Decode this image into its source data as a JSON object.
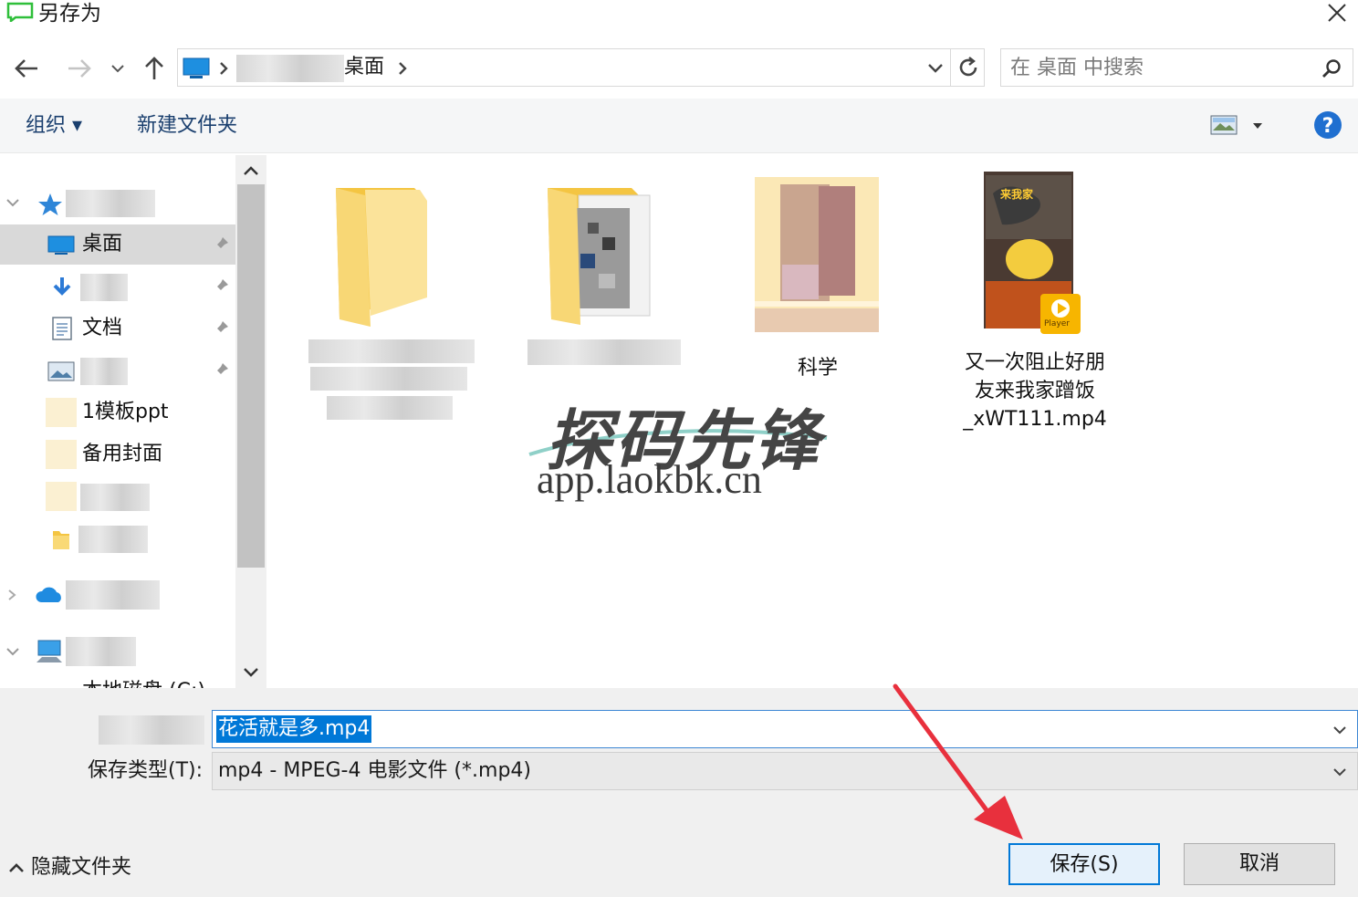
{
  "window": {
    "title": "另存为"
  },
  "address": {
    "current_folder": "桌面"
  },
  "search": {
    "placeholder": "在 桌面 中搜索"
  },
  "toolbar": {
    "organize_label": "组织 ▾",
    "new_folder_label": "新建文件夹"
  },
  "sidebar": {
    "items": [
      {
        "label": "桌面"
      },
      {
        "label": "文档"
      },
      {
        "label": "1模板ppt"
      },
      {
        "label": "备用封面"
      },
      {
        "label": "本地磁盘 (C:)"
      }
    ]
  },
  "files": [
    {
      "name": "科学"
    },
    {
      "name": "又一次阻止好朋友来我家蹭饭_xWT111.mp4",
      "lines": [
        "又一次阻止好朋",
        "友来我家蹭饭",
        "_xWT111.mp4"
      ]
    }
  ],
  "thumbnail_text": {
    "video_caption": "来我家",
    "player_label": "Player"
  },
  "watermark": {
    "title": "探码先锋",
    "url": "app.laokbk.cn"
  },
  "form": {
    "filename_value": "花活就是多.mp4",
    "filetype_label": "保存类型(T):",
    "filetype_value": "mp4 - MPEG-4 电影文件 (*.mp4)",
    "hide_folders_label": "隐藏文件夹",
    "save_label": "保存(S)",
    "cancel_label": "取消"
  },
  "colors": {
    "accent": "#0078d7",
    "folder": "#f8d775",
    "arrow": "#e8303d",
    "help": "#1f6fd0"
  }
}
